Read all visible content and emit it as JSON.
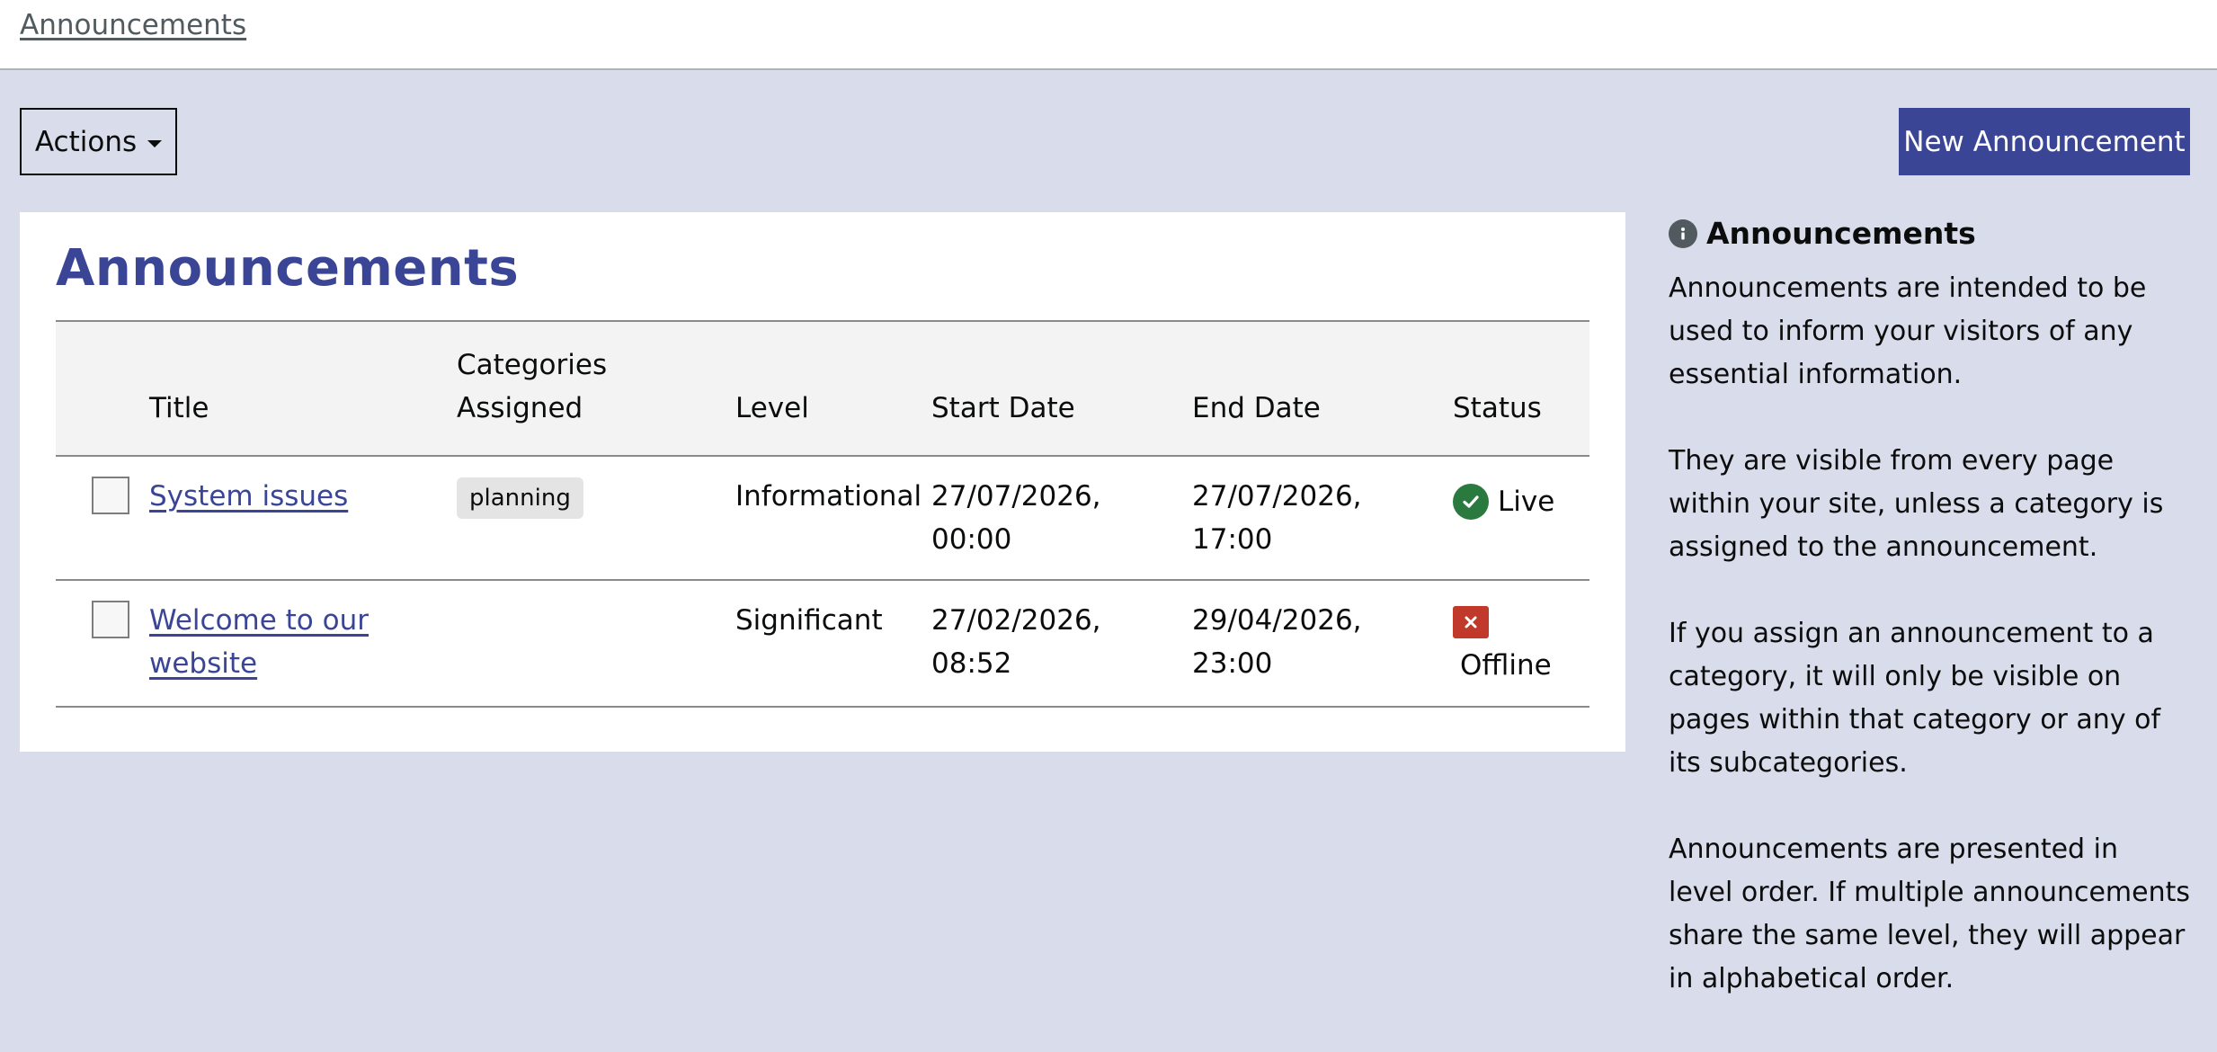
{
  "breadcrumb": {
    "label": "Announcements"
  },
  "toolbar": {
    "actions_label": "Actions",
    "new_label": "New Announcement"
  },
  "card": {
    "title": "Announcements",
    "columns": {
      "title": "Title",
      "categories_line1": "Categories",
      "categories_line2": "Assigned",
      "level": "Level",
      "start": "Start Date",
      "end": "End Date",
      "status": "Status"
    },
    "rows": [
      {
        "title": "System issues",
        "category": "planning",
        "level": "Informational",
        "start_line1": "27/07/2026,",
        "start_line2": "00:00",
        "end_line1": "27/07/2026,",
        "end_line2": "17:00",
        "status": "Live"
      },
      {
        "title_line1": "Welcome to our",
        "title_line2": "website",
        "level": "Significant",
        "start_line1": "27/02/2026,",
        "start_line2": "08:52",
        "end_line1": "29/04/2026,",
        "end_line2": "23:00",
        "status": "Offline"
      }
    ]
  },
  "sidebar": {
    "heading": "Announcements",
    "info_icon": "info-icon",
    "paragraphs": [
      "Announcements are intended to be used to inform your visitors of any essential information.",
      "They are visible from every page within your site, unless a category is assigned to the announcement.",
      "If you assign an announcement to a category, it will only be visible on pages within that category or any of its subcategories.",
      "Announcements are presented in level order. If multiple announcements share the same level, they will appear in alphabetical order."
    ]
  },
  "colors": {
    "brand": "#3a4596",
    "page_bg": "#d9dcea",
    "live": "#2a7a3f",
    "offline": "#c0392b"
  }
}
